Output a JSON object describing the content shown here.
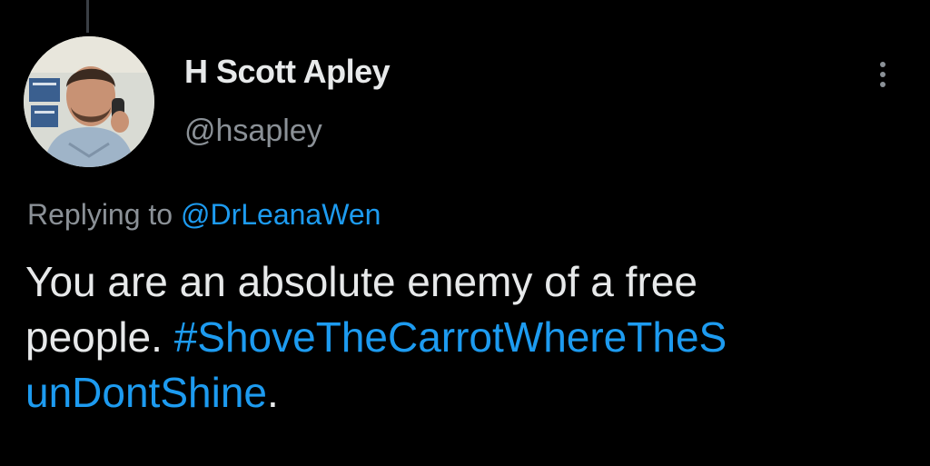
{
  "tweet": {
    "display_name": "H Scott Apley",
    "handle": "@hsapley",
    "reply_prefix": "Replying to ",
    "reply_mention": "@DrLeanaWen",
    "text_line1": "You are an absolute enemy of a free",
    "text_line2_plain": "people. ",
    "hashtag_part1": "#ShoveTheCarrotWhereTheS",
    "hashtag_part2": "unDontShine",
    "text_line3_end": "."
  },
  "icons": {
    "avatar": "profile-photo",
    "more": "more-options-icon"
  },
  "colors": {
    "background": "#000000",
    "primary_text": "#e7e9ea",
    "secondary_text": "#8b9197",
    "link": "#1d9bf0"
  }
}
